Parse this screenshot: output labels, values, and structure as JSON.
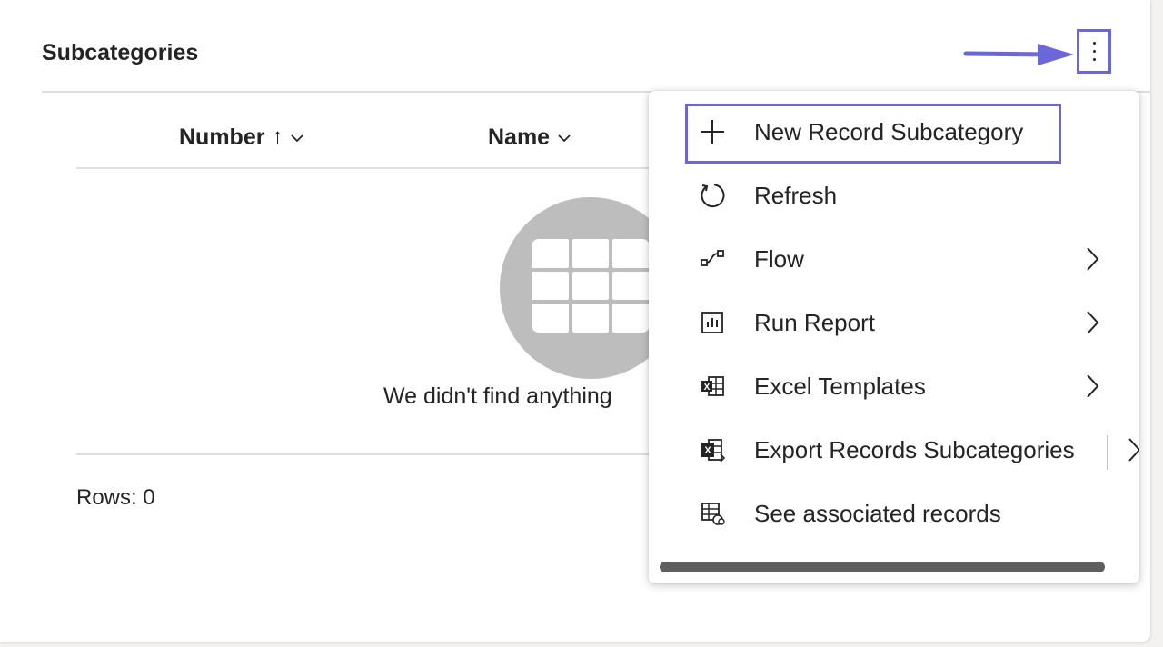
{
  "card": {
    "title": "Subcategories"
  },
  "grid": {
    "columns": [
      {
        "label": "Number",
        "sort_indicator": "↑",
        "menu_chevron": "⌄"
      },
      {
        "label": "Name",
        "menu_chevron": "⌄"
      }
    ],
    "empty_message": "We didn't find anything",
    "rows_label": "Rows: 0"
  },
  "overflow_menu": {
    "items": [
      {
        "label": "New Record Subcategory",
        "icon": "plus-icon",
        "has_submenu": false,
        "highlighted": true
      },
      {
        "label": "Refresh",
        "icon": "refresh-icon",
        "has_submenu": false
      },
      {
        "label": "Flow",
        "icon": "flow-icon",
        "has_submenu": true
      },
      {
        "label": "Run Report",
        "icon": "report-icon",
        "has_submenu": true
      },
      {
        "label": "Excel Templates",
        "icon": "excel-template-icon",
        "has_submenu": true
      },
      {
        "label": "Export Records Subcategories",
        "icon": "excel-export-icon",
        "has_submenu": true,
        "split_button": true
      },
      {
        "label": "See associated records",
        "icon": "associated-records-icon",
        "has_submenu": false
      }
    ]
  },
  "colors": {
    "annotation_accent": "#6b67d6",
    "text": "#242424",
    "empty_circle": "#bdbdbd"
  }
}
